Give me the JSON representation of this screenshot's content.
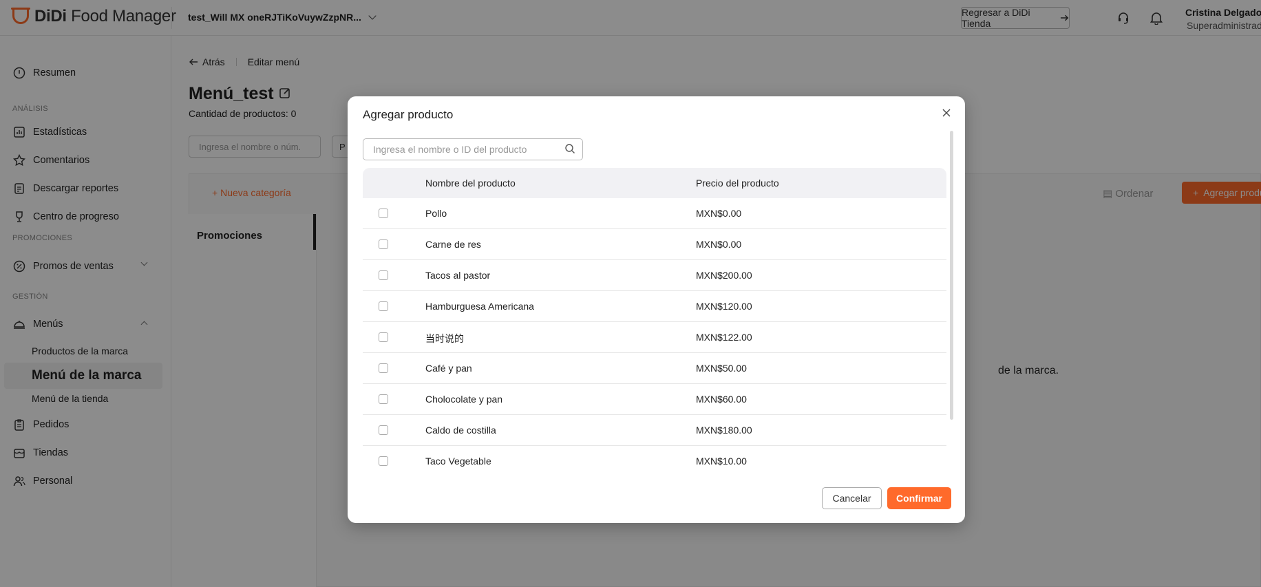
{
  "header": {
    "logo_bold": "DiDi",
    "logo_text": " Food Manager",
    "store_name": "test_Will MX oneRJTiKoVuywZzpNR...",
    "back_to_store_label": "Regresar a DiDi Tienda",
    "user_name": "Cristina Delgado",
    "user_role": "Superadministrador"
  },
  "sidebar": {
    "resumen": "Resumen",
    "section_analisis": "ANÁLISIS",
    "estadisticas": "Estadísticas",
    "comentarios": "Comentarios",
    "descargar_reportes": "Descargar reportes",
    "centro_progreso": "Centro de progreso",
    "section_promociones": "PROMOCIONES",
    "promos_ventas": "Promos de ventas",
    "section_gestion": "GESTIÓN",
    "menus": "Menús",
    "productos_marca": "Productos de la marca",
    "menu_marca": "Menú de la marca",
    "menu_tienda": "Menú de la tienda",
    "pedidos": "Pedidos",
    "tiendas": "Tiendas",
    "personal": "Personal"
  },
  "page": {
    "back_label": "Atrás",
    "breadcrumb_current": "Editar menú",
    "menu_title": "Menú_test",
    "product_count": "Cantidad de productos: 0",
    "search_placeholder": "Ingresa el nombre o núm.",
    "filter_initial": "P",
    "new_category_label": "Nueva categoría",
    "category_promociones": "Promociones",
    "ordenar_label": "Ordenar",
    "add_product_label": "Agregar producto",
    "empty_text_fragment": "de la marca."
  },
  "modal": {
    "title": "Agregar producto",
    "search_placeholder": "Ingresa el nombre o ID del producto",
    "col_name": "Nombre del producto",
    "col_price": "Precio del producto",
    "rows": [
      {
        "name": "Pollo",
        "price": "MXN$0.00"
      },
      {
        "name": "Carne de res",
        "price": "MXN$0.00"
      },
      {
        "name": "Tacos al pastor",
        "price": "MXN$200.00"
      },
      {
        "name": "Hamburguesa Americana",
        "price": "MXN$120.00"
      },
      {
        "name": "当时说的",
        "price": "MXN$122.00"
      },
      {
        "name": "Café y pan",
        "price": "MXN$50.00"
      },
      {
        "name": "Cholocolate y pan",
        "price": "MXN$60.00"
      },
      {
        "name": "Caldo de costilla",
        "price": "MXN$180.00"
      },
      {
        "name": "Taco Vegetable",
        "price": "MXN$10.00"
      }
    ],
    "cancel_label": "Cancelar",
    "confirm_label": "Confirmar"
  },
  "colors": {
    "accent": "#ff6a2b",
    "overlay": "rgba(0,0,0,0.45)"
  },
  "icons": [
    "logo-icon",
    "chevron-down-icon",
    "arrow-right-icon",
    "headset-icon",
    "bell-icon",
    "home-icon",
    "chart-icon",
    "star-icon",
    "document-icon",
    "trophy-icon",
    "percent-icon",
    "bell-tray-icon",
    "clipboard-icon",
    "store-icon",
    "people-icon",
    "arrow-left-icon",
    "edit-icon",
    "search-icon",
    "close-icon"
  ]
}
